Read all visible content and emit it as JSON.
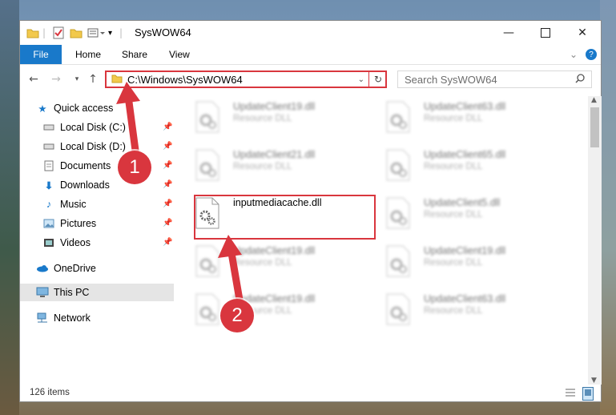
{
  "window": {
    "title": "SysWOW64",
    "minimize_icon": "minimize-icon",
    "maximize_icon": "maximize-icon",
    "close_icon": "close-icon"
  },
  "ribbon": {
    "tabs": [
      "File",
      "Home",
      "Share",
      "View"
    ]
  },
  "address": {
    "path": "C:\\Windows\\SysWOW64"
  },
  "search": {
    "placeholder": "Search SysWOW64"
  },
  "nav": {
    "quick_access": "Quick access",
    "items": [
      "Local Disk (C:)",
      "Local Disk (D:)",
      "Documents",
      "Downloads",
      "Music",
      "Pictures",
      "Videos"
    ],
    "onedrive": "OneDrive",
    "this_pc": "This PC",
    "network": "Network"
  },
  "files": [
    {
      "name": "UpdateClient19.dll",
      "type": "Resource DLL"
    },
    {
      "name": "UpdateClient63.dll",
      "type": "Resource DLL"
    },
    {
      "name": "UpdateClient21.dll",
      "type": "Resource DLL"
    },
    {
      "name": "UpdateClient65.dll",
      "type": "Resource DLL"
    },
    {
      "name": "inputmediacache.dll",
      "type": ""
    },
    {
      "name": "UpdateClient5.dll",
      "type": "Resource DLL"
    },
    {
      "name": "UpdateClient19.dll",
      "type": "Resource DLL"
    },
    {
      "name": "UpdateClient19.dll",
      "type": "Resource DLL"
    },
    {
      "name": "UpdateClient19.dll",
      "type": "Resource DLL"
    },
    {
      "name": "UpdateClient63.dll",
      "type": "Resource DLL"
    }
  ],
  "status": {
    "items": "126 items"
  },
  "annotations": {
    "step1": "1",
    "step2": "2",
    "color": "#d9363e"
  }
}
